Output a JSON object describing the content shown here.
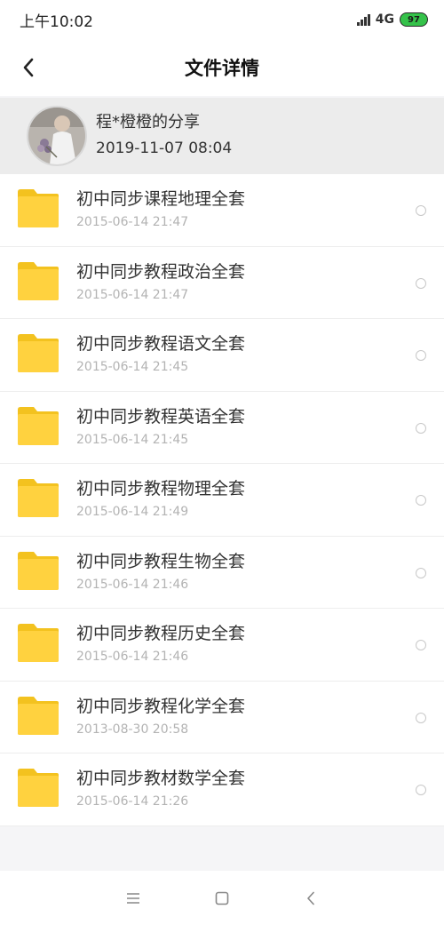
{
  "status_bar": {
    "time": "上午10:02",
    "network": "4G",
    "battery": "97"
  },
  "header": {
    "title": "文件详情",
    "back_icon": "chevron-left-icon"
  },
  "share": {
    "name": "程*橙橙的分享",
    "datetime": "2019-11-07  08:04"
  },
  "files": [
    {
      "name": "初中同步课程地理全套",
      "date": "2015-06-14  21:47"
    },
    {
      "name": "初中同步教程政治全套",
      "date": "2015-06-14  21:47"
    },
    {
      "name": "初中同步教程语文全套",
      "date": "2015-06-14  21:45"
    },
    {
      "name": "初中同步教程英语全套",
      "date": "2015-06-14  21:45"
    },
    {
      "name": "初中同步教程物理全套",
      "date": "2015-06-14  21:49"
    },
    {
      "name": "初中同步教程生物全套",
      "date": "2015-06-14  21:46"
    },
    {
      "name": "初中同步教程历史全套",
      "date": "2015-06-14  21:46"
    },
    {
      "name": "初中同步教程化学全套",
      "date": "2013-08-30  20:58"
    },
    {
      "name": "初中同步教材数学全套",
      "date": "2015-06-14  21:26"
    }
  ],
  "colors": {
    "folder": "#ffd23f",
    "folder_tab": "#f3c21f",
    "battery": "#35c24a"
  },
  "nav": {
    "menu_icon": "menu-icon",
    "home_icon": "square-home-icon",
    "back_icon": "chevron-left-icon"
  }
}
